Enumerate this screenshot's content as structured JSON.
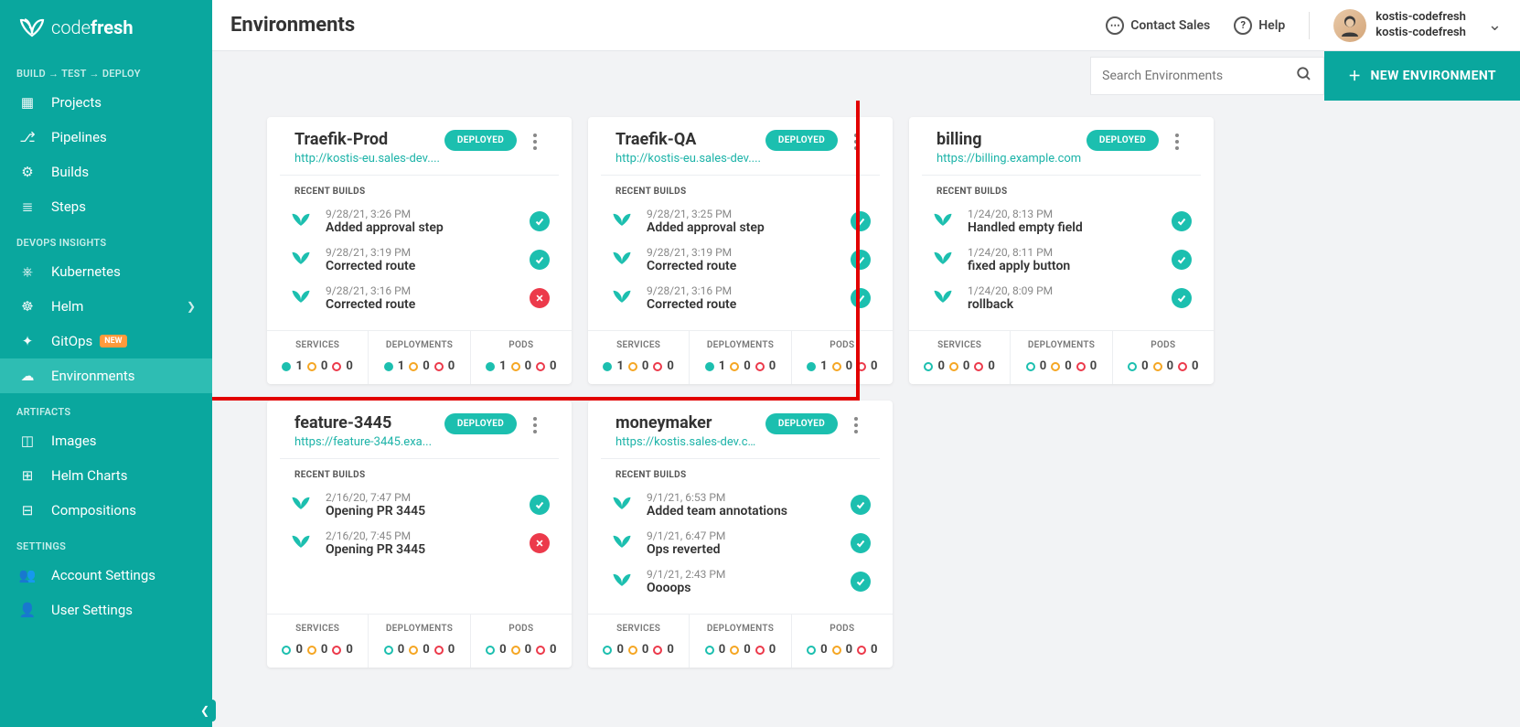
{
  "header": {
    "page_title": "Environments",
    "contact_sales": "Contact Sales",
    "help": "Help",
    "user_line1": "kostis-codefresh",
    "user_line2": "kostis-codefresh"
  },
  "toolbar": {
    "search_placeholder": "Search Environments",
    "new_env": "NEW ENVIRONMENT"
  },
  "sidebar": {
    "section_build": "BUILD  →  TEST  →  DEPLOY",
    "projects": "Projects",
    "pipelines": "Pipelines",
    "builds": "Builds",
    "steps": "Steps",
    "section_devops": "DEVOPS INSIGHTS",
    "kubernetes": "Kubernetes",
    "helm": "Helm",
    "gitops": "GitOps",
    "gitops_badge": "NEW",
    "environments": "Environments",
    "section_artifacts": "ARTIFACTS",
    "images": "Images",
    "helm_charts": "Helm Charts",
    "compositions": "Compositions",
    "section_settings": "SETTINGS",
    "account_settings": "Account Settings",
    "user_settings": "User Settings"
  },
  "labels": {
    "recent_builds": "RECENT BUILDS",
    "services": "SERVICES",
    "deployments": "DEPLOYMENTS",
    "pods": "PODS",
    "deployed": "DEPLOYED"
  },
  "cards": [
    {
      "name": "Traefik-Prod",
      "url": "http://kostis-eu.sales-dev....",
      "builds": [
        {
          "date": "9/28/21, 3:26 PM",
          "title": "Added approval step",
          "status": "ok"
        },
        {
          "date": "9/28/21, 3:19 PM",
          "title": "Corrected route",
          "status": "ok"
        },
        {
          "date": "9/28/21, 3:16 PM",
          "title": "Corrected route",
          "status": "fail"
        }
      ],
      "footer": [
        {
          "filled": true,
          "v": [
            1,
            0,
            0
          ]
        },
        {
          "filled": true,
          "v": [
            1,
            0,
            0
          ]
        },
        {
          "filled": true,
          "v": [
            1,
            0,
            0
          ]
        }
      ]
    },
    {
      "name": "Traefik-QA",
      "url": "http://kostis-eu.sales-dev....",
      "builds": [
        {
          "date": "9/28/21, 3:25 PM",
          "title": "Added approval step",
          "status": "ok"
        },
        {
          "date": "9/28/21, 3:19 PM",
          "title": "Corrected route",
          "status": "ok"
        },
        {
          "date": "9/28/21, 3:16 PM",
          "title": "Corrected route",
          "status": "ok"
        }
      ],
      "footer": [
        {
          "filled": true,
          "v": [
            1,
            0,
            0
          ]
        },
        {
          "filled": true,
          "v": [
            1,
            0,
            0
          ]
        },
        {
          "filled": true,
          "v": [
            1,
            0,
            0
          ]
        }
      ]
    },
    {
      "name": "billing",
      "url": "https://billing.example.com",
      "builds": [
        {
          "date": "1/24/20, 8:13 PM",
          "title": "Handled empty field",
          "status": "ok"
        },
        {
          "date": "1/24/20, 8:11 PM",
          "title": "fixed apply button",
          "status": "ok"
        },
        {
          "date": "1/24/20, 8:09 PM",
          "title": "rollback",
          "status": "ok"
        }
      ],
      "footer": [
        {
          "filled": false,
          "v": [
            0,
            0,
            0
          ]
        },
        {
          "filled": false,
          "v": [
            0,
            0,
            0
          ]
        },
        {
          "filled": false,
          "v": [
            0,
            0,
            0
          ]
        }
      ]
    },
    {
      "name": "feature-3445",
      "url": "https://feature-3445.exa...",
      "builds": [
        {
          "date": "2/16/20, 7:47 PM",
          "title": "Opening PR 3445",
          "status": "ok"
        },
        {
          "date": "2/16/20, 7:45 PM",
          "title": "Opening PR 3445",
          "status": "fail"
        }
      ],
      "footer": [
        {
          "filled": false,
          "v": [
            0,
            0,
            0
          ]
        },
        {
          "filled": false,
          "v": [
            0,
            0,
            0
          ]
        },
        {
          "filled": false,
          "v": [
            0,
            0,
            0
          ]
        }
      ]
    },
    {
      "name": "moneymaker",
      "url": "https://kostis.sales-dev.co...",
      "builds": [
        {
          "date": "9/1/21, 6:53 PM",
          "title": "Added team annotations",
          "status": "ok"
        },
        {
          "date": "9/1/21, 6:47 PM",
          "title": "Ops reverted",
          "status": "ok"
        },
        {
          "date": "9/1/21, 2:43 PM",
          "title": "Oooops",
          "status": "ok"
        }
      ],
      "footer": [
        {
          "filled": false,
          "v": [
            0,
            0,
            0
          ]
        },
        {
          "filled": false,
          "v": [
            0,
            0,
            0
          ]
        },
        {
          "filled": false,
          "v": [
            0,
            0,
            0
          ]
        }
      ]
    }
  ]
}
